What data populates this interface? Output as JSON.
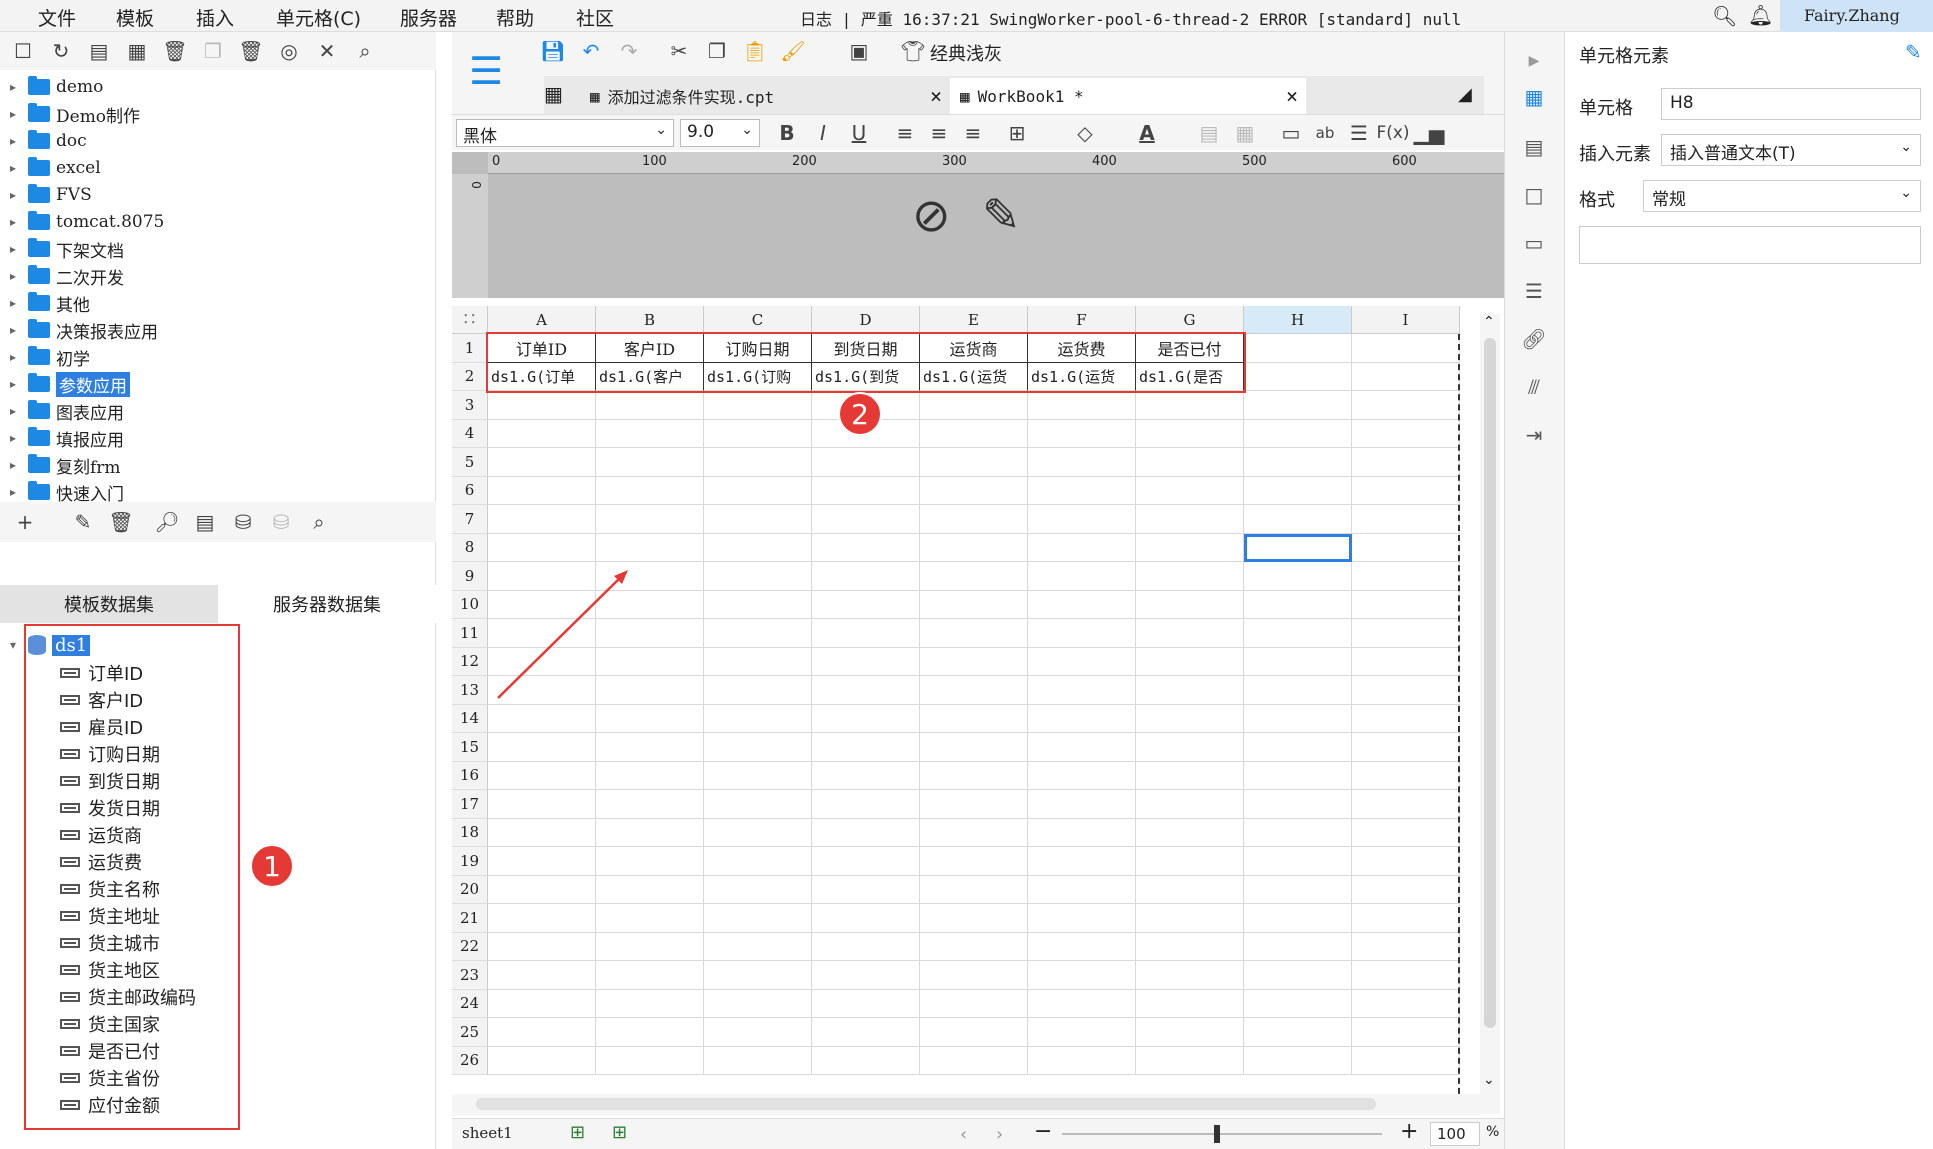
{
  "menu": [
    "文件",
    "模板",
    "插入",
    "单元格(C)",
    "服务器",
    "帮助",
    "社区"
  ],
  "log_text": "日志 | 严重 16:37:21 SwingWorker-pool-6-thread-2 ERROR [standard] null",
  "user": "Fairy.Zhang",
  "tree": [
    {
      "label": "demo"
    },
    {
      "label": "Demo制作"
    },
    {
      "label": "doc"
    },
    {
      "label": "excel"
    },
    {
      "label": "FVS"
    },
    {
      "label": "tomcat.8075"
    },
    {
      "label": "下架文档"
    },
    {
      "label": "二次开发"
    },
    {
      "label": "其他"
    },
    {
      "label": "决策报表应用"
    },
    {
      "label": "初学"
    },
    {
      "label": "参数应用"
    },
    {
      "label": "图表应用"
    },
    {
      "label": "填报应用"
    },
    {
      "label": "复刻frm"
    },
    {
      "label": "快速入门"
    }
  ],
  "dataset_tabs": [
    "模板数据集",
    "服务器数据集"
  ],
  "dataset_name": "ds1",
  "fields": [
    "订单ID",
    "客户ID",
    "雇员ID",
    "订购日期",
    "到货日期",
    "发货日期",
    "运货商",
    "运货费",
    "货主名称",
    "货主地址",
    "货主城市",
    "货主地区",
    "货主邮政编码",
    "货主国家",
    "是否已付",
    "货主省份",
    "应付金额"
  ],
  "file_tabs": [
    {
      "name": "添加过滤条件实现.cpt",
      "close": "×"
    },
    {
      "name": "WorkBook1 *",
      "close": "×"
    }
  ],
  "classic_label": "经典浅灰",
  "font_name": "黑体",
  "font_size": "9.0",
  "ruler_marks": [
    "0",
    "100",
    "200",
    "300",
    "400",
    "500",
    "600"
  ],
  "columns": [
    "A",
    "B",
    "C",
    "D",
    "E",
    "F",
    "G",
    "H",
    "I"
  ],
  "rows": [
    "1",
    "2",
    "3",
    "4",
    "5",
    "6",
    "7",
    "8",
    "9",
    "10",
    "11",
    "12",
    "13",
    "14",
    "15",
    "16",
    "17",
    "18",
    "19",
    "20",
    "21",
    "22",
    "23",
    "24",
    "25",
    "26"
  ],
  "header_cells": [
    "订单ID",
    "客户ID",
    "订购日期",
    "到货日期",
    "运货商",
    "运货费",
    "是否已付"
  ],
  "data_cells": [
    "ds1.G(订单",
    "ds1.G(客户",
    "ds1.G(订购",
    "ds1.G(到货",
    "ds1.G(运货",
    "ds1.G(运货",
    "ds1.G(是否"
  ],
  "badges": [
    "1",
    "2"
  ],
  "sheet_name": "sheet1",
  "zoom": "100",
  "zoom_unit": "%",
  "right_panel": {
    "title": "单元格元素",
    "cell_label": "单元格",
    "cell_value": "H8",
    "insert_label": "插入元素",
    "insert_value": "插入普通文本(T)",
    "format_label": "格式",
    "format_value": "常规"
  },
  "colors": {
    "accent": "#2f7fe0",
    "red": "#e53935",
    "folder": "#1e88e5"
  }
}
